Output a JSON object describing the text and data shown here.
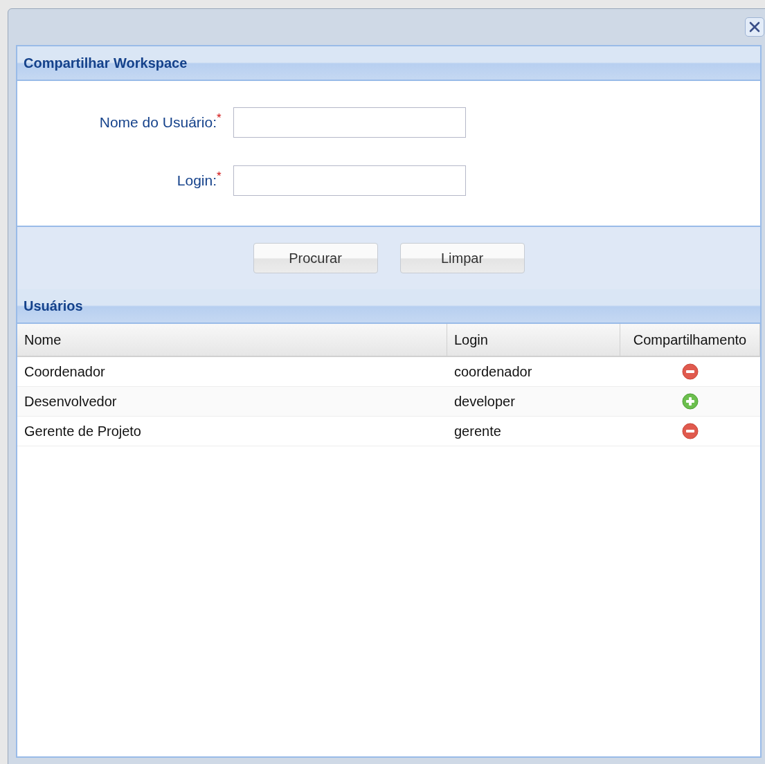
{
  "form_panel": {
    "title": "Compartilhar Workspace",
    "fields": [
      {
        "label": "Nome do Usuário:",
        "required_mark": "*"
      },
      {
        "label": "Login:",
        "required_mark": "*"
      }
    ]
  },
  "buttons": [
    "Procurar",
    "Limpar"
  ],
  "users_panel": {
    "title": "Usuários",
    "columns": [
      "Nome",
      "Login",
      "Compartilhamento"
    ],
    "rows": [
      {
        "name": "Coordenador",
        "login": "coordenador",
        "shared": true
      },
      {
        "name": "Desenvolvedor",
        "login": "developer",
        "shared": false
      },
      {
        "name": "Gerente de Projeto",
        "login": "gerente",
        "shared": true
      }
    ]
  }
}
